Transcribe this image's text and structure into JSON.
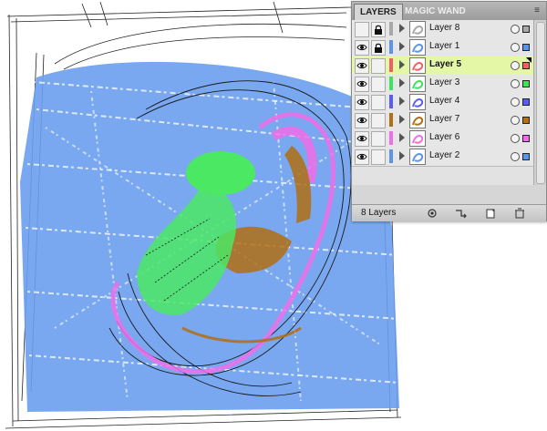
{
  "layers_panel": {
    "tabs": [
      {
        "label": "LAYERS"
      },
      {
        "label": "MAGIC WAND"
      }
    ],
    "layers": [
      {
        "name": "Layer 8",
        "visible": false,
        "locked": true,
        "color": "#a8a8a8",
        "selected": false
      },
      {
        "name": "Layer 1",
        "visible": true,
        "locked": true,
        "color": "#5b95ea",
        "selected": false
      },
      {
        "name": "Layer 5",
        "visible": true,
        "locked": false,
        "color": "#f06060",
        "selected": true
      },
      {
        "name": "Layer 3",
        "visible": true,
        "locked": false,
        "color": "#3ee35c",
        "selected": false
      },
      {
        "name": "Layer 4",
        "visible": true,
        "locked": false,
        "color": "#5a5ef0",
        "selected": false
      },
      {
        "name": "Layer 7",
        "visible": true,
        "locked": false,
        "color": "#b26f14",
        "selected": false
      },
      {
        "name": "Layer 6",
        "visible": true,
        "locked": false,
        "color": "#f06ee8",
        "selected": false
      },
      {
        "name": "Layer 2",
        "visible": true,
        "locked": false,
        "color": "#5b95ea",
        "selected": false
      }
    ],
    "footer": {
      "count_label": "8 Layers"
    }
  },
  "icons": [
    "eye-icon",
    "lock-icon",
    "expand-arrow-icon",
    "panel-menu-icon",
    "make-clipping-mask-icon",
    "create-sublayer-icon",
    "new-layer-icon",
    "delete-layer-icon"
  ],
  "colors": {
    "blue_trace": "#5b95ea",
    "green_trace": "#4be864",
    "pink_trace": "#f06ee8",
    "brown_trace": "#b26f14",
    "selected_row": "#e3f7a6"
  }
}
